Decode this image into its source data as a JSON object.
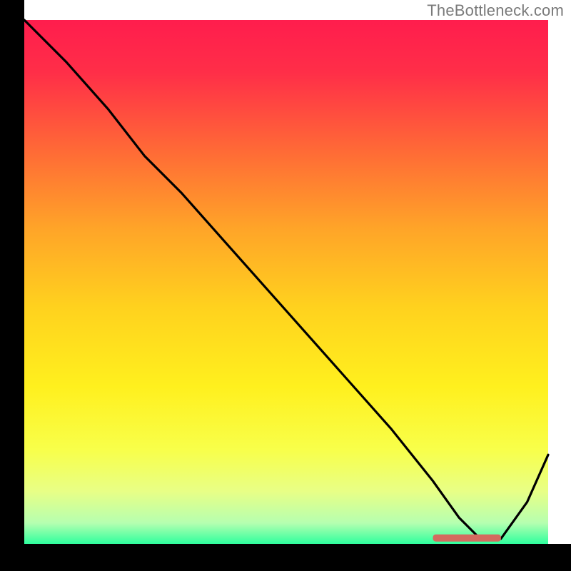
{
  "watermark": "TheBottleneck.com",
  "colors": {
    "curve": "#000000",
    "highlight": "#d46a5f",
    "gradient_top": "#ff1d4d",
    "gradient_bottom": "#2fff9e",
    "axis": "#000000"
  },
  "chart_data": {
    "type": "line",
    "title": "",
    "xlabel": "",
    "ylabel": "",
    "xlim": [
      0,
      100
    ],
    "ylim": [
      0,
      100
    ],
    "x": [
      0,
      8,
      16,
      23,
      30,
      38,
      46,
      54,
      62,
      70,
      78,
      83,
      87,
      91,
      96,
      100
    ],
    "values": [
      100,
      92,
      83,
      74,
      67,
      58,
      49,
      40,
      31,
      22,
      12,
      5,
      1,
      1,
      8,
      17
    ],
    "highlight_range_x": [
      78,
      91
    ],
    "highlight_y": 1
  }
}
